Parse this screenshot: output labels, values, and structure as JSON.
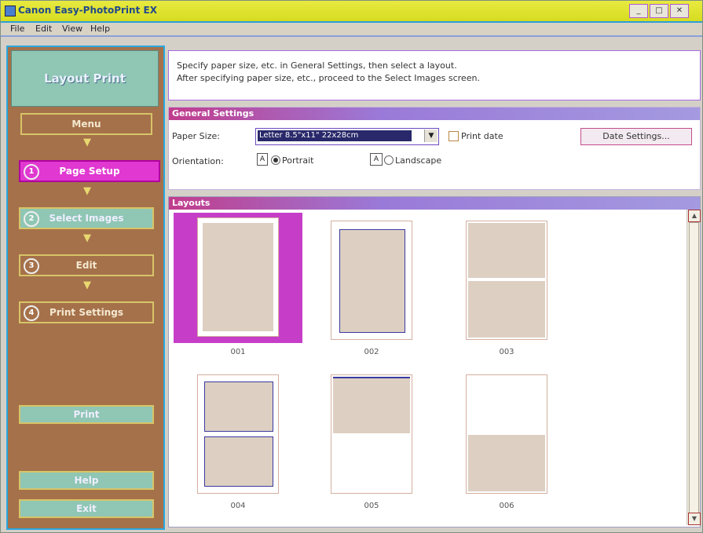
{
  "window": {
    "title": "Canon Easy-PhotoPrint EX",
    "buttons": [
      "_",
      "□",
      "✕"
    ]
  },
  "menu": [
    "File",
    "Edit",
    "View",
    "Help"
  ],
  "sidebar": {
    "logo": "Layout Print",
    "items": [
      {
        "label": "Menu",
        "num": ""
      },
      {
        "label": "Page Setup",
        "num": "1"
      },
      {
        "label": "Select Images",
        "num": "2"
      },
      {
        "label": "Edit",
        "num": "3"
      },
      {
        "label": "Print Settings",
        "num": "4"
      }
    ],
    "print_label": "Print",
    "help_label": "Help",
    "exit_label": "Exit"
  },
  "instructions": {
    "line1": "Specify paper size, etc. in General Settings, then select a layout.",
    "line2": "After specifying paper size, etc., proceed to the Select Images screen."
  },
  "general_settings": {
    "heading": "General Settings",
    "paper_size_label": "Paper Size:",
    "paper_size_value": "Letter 8.5\"x11\" 22x28cm",
    "print_date_label": "Print date",
    "date_settings_label": "Date Settings...",
    "orientation_label": "Orientation:",
    "portrait_label": "Portrait",
    "landscape_label": "Landscape",
    "orientation_selected": "Portrait"
  },
  "layouts": {
    "heading": "Layouts",
    "selected": "001",
    "items": [
      "001",
      "002",
      "003",
      "004",
      "005",
      "006"
    ]
  }
}
